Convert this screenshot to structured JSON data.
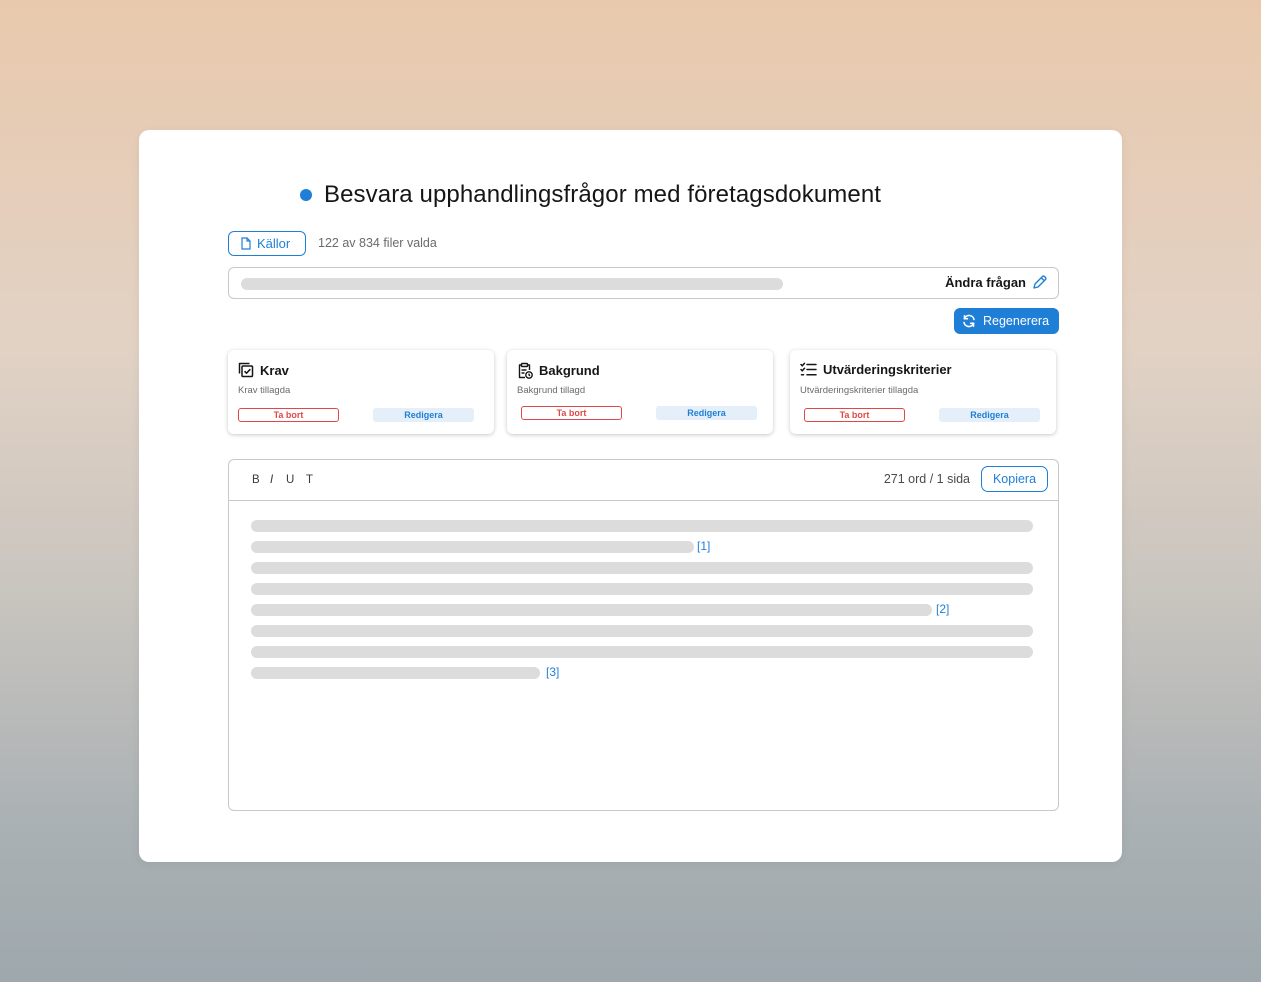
{
  "header": {
    "title": "Besvara upphandlingsfrågor med företagsdokument",
    "accent_color": "#1f7fd6"
  },
  "sources": {
    "button_label": "Källor",
    "icon": "document-icon",
    "files_selected": "122 av 834 filer valda"
  },
  "question": {
    "edit_label": "Ändra frågan",
    "edit_icon": "pencil-icon"
  },
  "regenerate": {
    "label": "Regenerera",
    "icon": "refresh-icon"
  },
  "cards": [
    {
      "title": "Krav",
      "icon": "checkbox-stack-icon",
      "subtitle": "Krav tillagda",
      "remove_label": "Ta bort",
      "edit_label": "Redigera"
    },
    {
      "title": "Bakgrund",
      "icon": "clipboard-clock-icon",
      "subtitle": "Bakgrund tillagd",
      "remove_label": "Ta bort",
      "edit_label": "Redigera"
    },
    {
      "title": "Utvärderingskriterier",
      "icon": "checklist-icon",
      "subtitle": "Utvärderingskriterier tillagda",
      "remove_label": "Ta bort",
      "edit_label": "Redigera"
    }
  ],
  "editor": {
    "format_buttons": [
      "B",
      "I",
      "U",
      "T"
    ],
    "word_count": "271 ord / 1 sida",
    "copy_label": "Kopiera",
    "citations": [
      "[1]",
      "[2]",
      "[3]"
    ]
  },
  "colors": {
    "danger": "#e04848",
    "skeleton": "#dcdcdc"
  }
}
